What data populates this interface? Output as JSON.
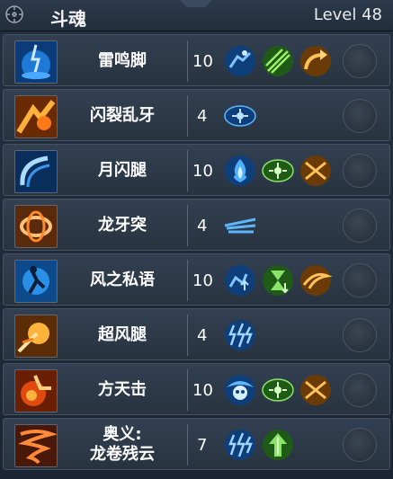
{
  "header": {
    "title": "斗魂",
    "level_label": "Level 48"
  },
  "skills": [
    {
      "name": "雷鸣脚",
      "level": "10",
      "runes": [
        "dash-rune-icon",
        "green-slash-rune-icon",
        "orange-arc-rune-icon"
      ]
    },
    {
      "name": "闪裂乱牙",
      "level": "4",
      "runes": [
        "blue-spread-rune-icon"
      ]
    },
    {
      "name": "月闪腿",
      "level": "10",
      "runes": [
        "blue-flame-rune-icon",
        "green-spread-rune-icon",
        "orange-cross-rune-icon"
      ]
    },
    {
      "name": "龙牙突",
      "level": "4",
      "runes": [
        "blue-stream-rune-icon"
      ]
    },
    {
      "name": "风之私语",
      "level": "10",
      "runes": [
        "blue-move-rune-icon",
        "green-hourglass-rune-icon",
        "orange-swirl-rune-icon"
      ]
    },
    {
      "name": "超风腿",
      "level": "4",
      "runes": [
        "blue-bolt-rune-icon"
      ]
    },
    {
      "name": "方天击",
      "level": "10",
      "runes": [
        "blue-skull-rune-icon",
        "green-spread-rune-icon",
        "orange-cross-rune-icon"
      ]
    },
    {
      "name_line1": "奥义:",
      "name_line2": "龙卷残云",
      "level": "7",
      "runes": [
        "blue-bolt-rune-icon",
        "green-arrow-rune-icon"
      ]
    }
  ],
  "colors": {
    "blue_rune": "#3aa6ff",
    "green_rune": "#5fd35a",
    "orange_rune": "#f2a230",
    "row_bg": "#2e3a4a"
  }
}
